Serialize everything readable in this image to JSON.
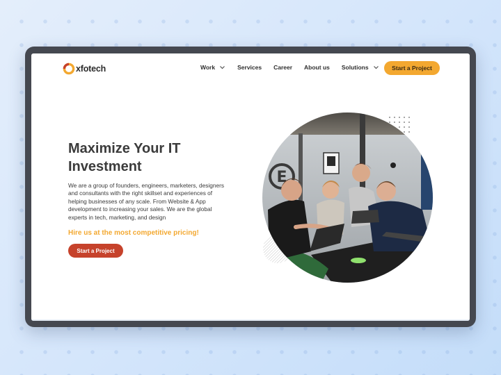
{
  "brand": {
    "name": "xfotech",
    "icon": "circle-logo-icon",
    "colors": {
      "orange": "#f3a830",
      "red": "#c6422b"
    }
  },
  "nav": {
    "items": [
      {
        "label": "Work",
        "dropdown": true
      },
      {
        "label": "Services",
        "dropdown": false
      },
      {
        "label": "Career",
        "dropdown": false
      },
      {
        "label": "About us",
        "dropdown": false
      },
      {
        "label": "Solutions",
        "dropdown": true
      }
    ],
    "cta_label": "Start a  Project"
  },
  "hero": {
    "title_line1": "Maximize Your IT",
    "title_line2": "Investment",
    "description": "We are a group of founders, engineers, marketers, designers and consultants with the right skillset and experiences of helping businesses of any scale. From Website & App development to increasing your sales. We are the global experts in tech, marketing, and design",
    "promo": "Hire us at the most competitive pricing!",
    "cta_label": "Start a  Project",
    "photo_logo_letter": "E"
  }
}
